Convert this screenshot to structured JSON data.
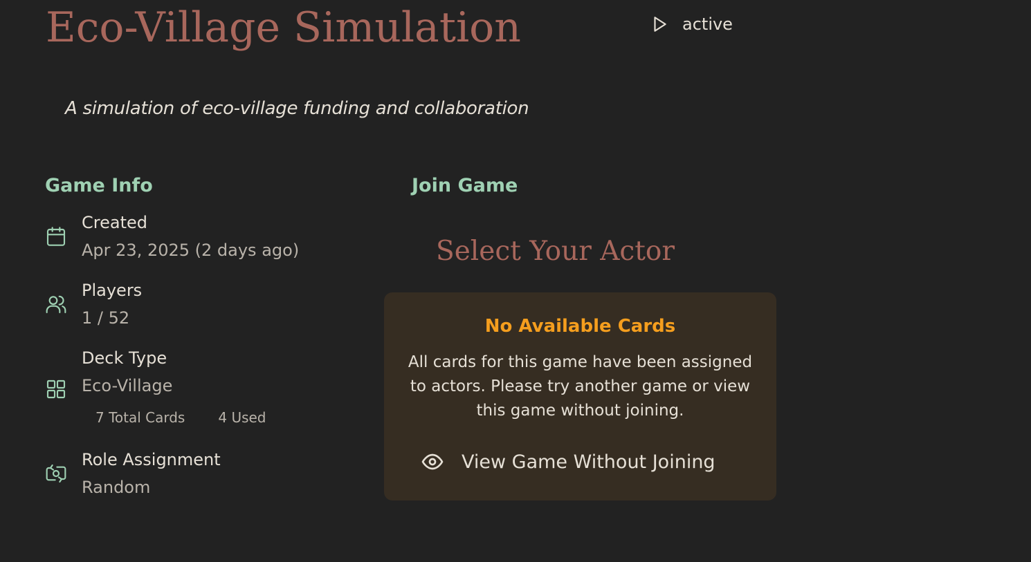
{
  "header": {
    "title": "Eco-Village Simulation",
    "status": "active",
    "status_icon": "play-icon",
    "subtitle": "A simulation of eco-village funding and collaboration"
  },
  "game_info": {
    "heading": "Game Info",
    "created": {
      "icon": "calendar-icon",
      "label": "Created",
      "value": "Apr 23, 2025 (2 days ago)"
    },
    "players": {
      "icon": "users-icon",
      "label": "Players",
      "value": "1 / 52"
    },
    "deck": {
      "icon": "grid-icon",
      "label": "Deck Type",
      "value": "Eco-Village",
      "total_cards": "7 Total Cards",
      "used_cards": "4 Used"
    },
    "role": {
      "icon": "shuffle-camera-icon",
      "label": "Role Assignment",
      "value": "Random"
    }
  },
  "join_game": {
    "heading": "Join Game",
    "select_heading": "Select Your Actor",
    "panel": {
      "title": "No Available Cards",
      "message": "All cards for this game have been assigned to actors. Please try another game or view this game without joining.",
      "button_label": "View Game Without Joining",
      "button_icon": "eye-icon"
    }
  },
  "colors": {
    "background": "#222222",
    "title": "#a8675c",
    "section_heading": "#9fd1b3",
    "panel_background": "#362d22",
    "warning": "#f59e1e",
    "text": "#e6e0d6",
    "muted_text": "#b9b3aa"
  }
}
